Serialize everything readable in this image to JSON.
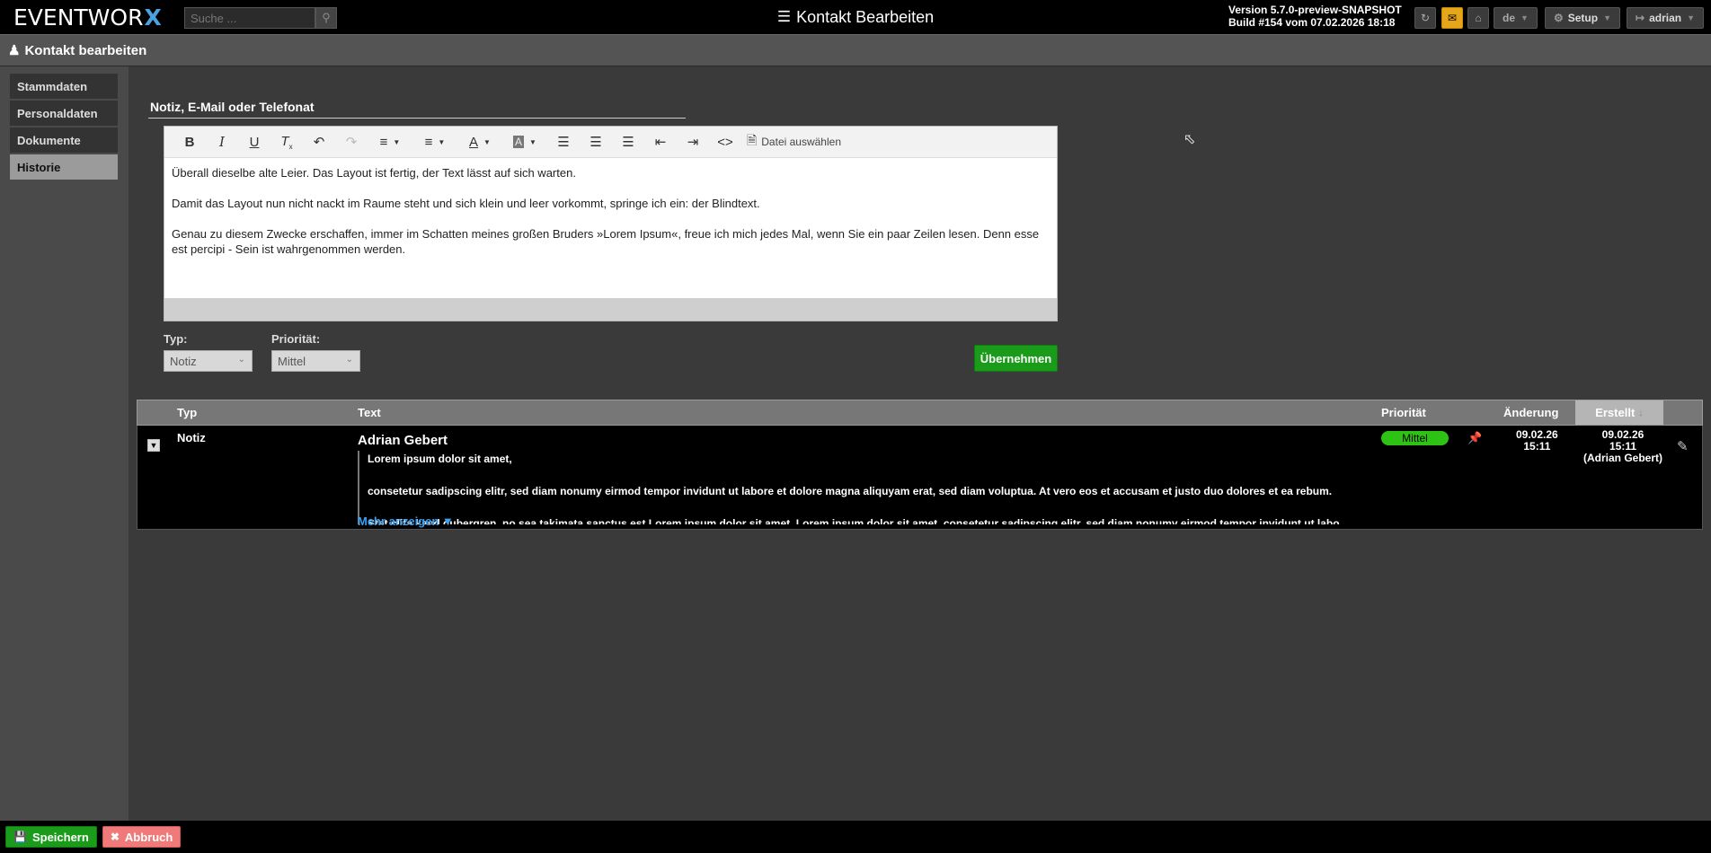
{
  "app": {
    "logo_text": "EVENTWOR",
    "logo_x": "X",
    "search_placeholder": "Suche ...",
    "page_title": "Kontakt Bearbeiten",
    "version_line1": "Version 5.7.0-preview-SNAPSHOT",
    "version_line2": "Build #154 vom 07.02.2026 18:18",
    "language": "de",
    "setup_label": "Setup",
    "user_label": "adrian"
  },
  "subheader": {
    "title": "Kontakt bearbeiten"
  },
  "sidebar": {
    "items": [
      {
        "label": "Stammdaten",
        "active": false
      },
      {
        "label": "Personaldaten",
        "active": false
      },
      {
        "label": "Dokumente",
        "active": false
      },
      {
        "label": "Historie",
        "active": true
      }
    ]
  },
  "form": {
    "section_title": "Notiz, E-Mail oder Telefonat",
    "file_button": "Datei auswählen",
    "editor_paragraphs": [
      "Überall dieselbe alte Leier. Das Layout ist fertig, der Text lässt auf sich warten.",
      "Damit das Layout nun nicht nackt im Raume steht und sich klein und leer vorkommt, springe ich ein: der Blindtext.",
      "Genau zu diesem Zwecke erschaffen, immer im Schatten meines großen Bruders »Lorem Ipsum«, freue ich mich jedes Mal, wenn Sie ein paar Zeilen lesen. Denn esse est percipi - Sein ist wahrgenommen werden."
    ],
    "type_label": "Typ:",
    "type_value": "Notiz",
    "priority_label": "Priorität:",
    "priority_value": "Mittel",
    "apply_button": "Übernehmen"
  },
  "table": {
    "headers": {
      "type": "Typ",
      "text": "Text",
      "priority": "Priorität",
      "changed": "Änderung",
      "created": "Erstellt"
    },
    "rows": [
      {
        "type": "Notiz",
        "author": "Adrian Gebert",
        "lines": [
          "Lorem ipsum dolor sit amet,",
          "consetetur sadipscing elitr, sed diam nonumy eirmod tempor invidunt ut labore et dolore magna aliquyam erat, sed diam voluptua. At vero eos et accusam et justo duo dolores et ea rebum.",
          "Stet clita kasd gubergren, no sea takimata sanctus est Lorem ipsum dolor sit amet. Lorem ipsum dolor sit amet, consetetur sadipscing elitr, sed diam nonumy eirmod tempor invidunt ut labo…"
        ],
        "more_link": "Mehr anzeigen ▼",
        "priority": "Mittel",
        "changed_date": "09.02.26",
        "changed_time": "15:11",
        "created_date": "09.02.26",
        "created_time": "15:11",
        "created_by": "(Adrian Gebert)"
      }
    ]
  },
  "footer": {
    "save_button": "Speichern",
    "cancel_button": "Abbruch"
  },
  "colors": {
    "accent_green": "#1a9b1a",
    "mail_orange": "#e6a619",
    "link_blue": "#3aa0f0",
    "cancel_red": "#f07a7a"
  }
}
